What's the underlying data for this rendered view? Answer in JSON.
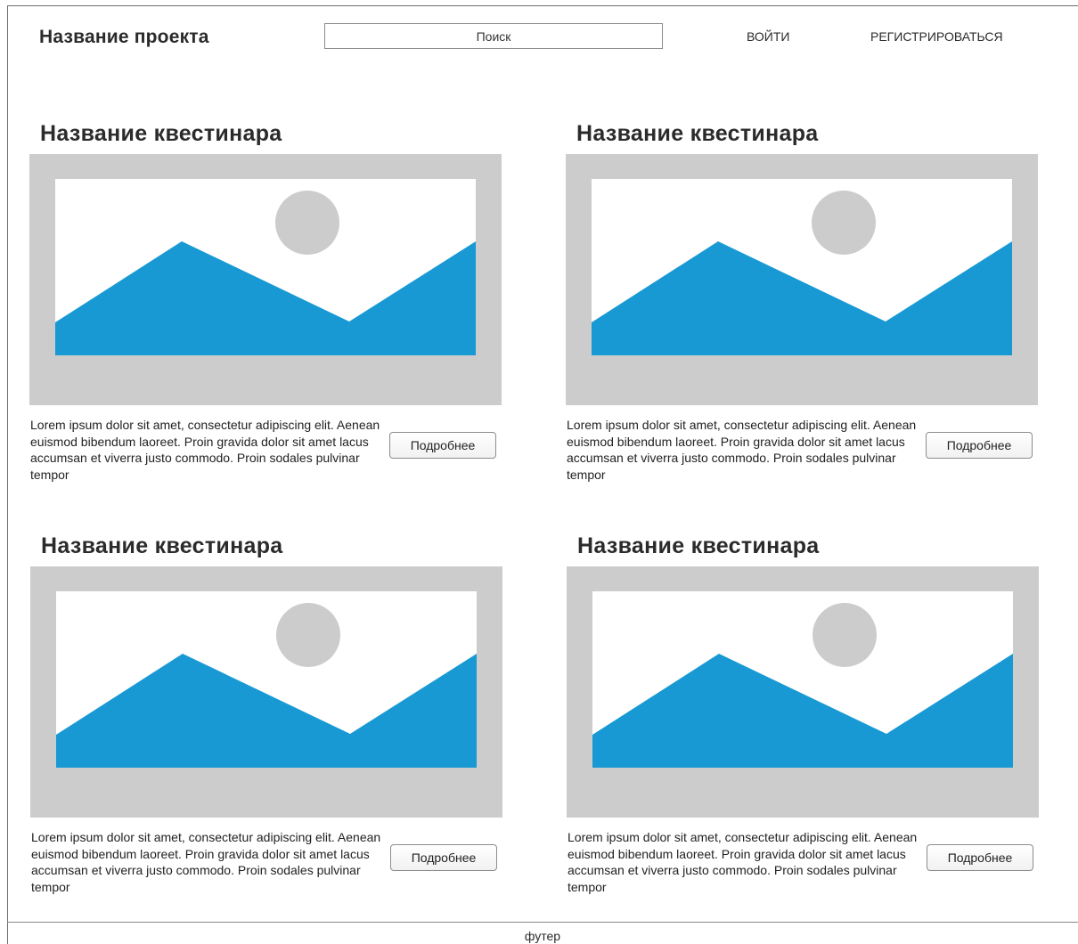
{
  "header": {
    "project_title": "Название проекта",
    "search_placeholder": "Поиск",
    "login_label": "ВОЙТИ",
    "register_label": "РЕГИСТРИРОВАТЬСЯ"
  },
  "cards": [
    {
      "title": "Название квестинара",
      "description": "Lorem ipsum dolor sit amet, consectetur adipiscing elit. Aenean euismod bibendum laoreet. Proin gravida dolor sit amet lacus accumsan et viverra justo commodo. Proin sodales pulvinar tempor",
      "button_label": "Подробнее",
      "image_icon": "image-placeholder-icon"
    },
    {
      "title": "Название квестинара",
      "description": "Lorem ipsum dolor sit amet, consectetur adipiscing elit. Aenean euismod bibendum laoreet. Proin gravida dolor sit amet lacus accumsan et viverra justo commodo. Proin sodales pulvinar tempor",
      "button_label": "Подробнее",
      "image_icon": "image-placeholder-icon"
    },
    {
      "title": "Название квестинара",
      "description": "Lorem ipsum dolor sit amet, consectetur adipiscing elit. Aenean euismod bibendum laoreet. Proin gravida dolor sit amet lacus accumsan et viverra justo commodo. Proin sodales pulvinar tempor",
      "button_label": "Подробнее",
      "image_icon": "image-placeholder-icon"
    },
    {
      "title": "Название квестинара",
      "description": "Lorem ipsum dolor sit amet, consectetur adipiscing elit. Aenean euismod bibendum laoreet. Proin gravida dolor sit amet lacus accumsan et viverra justo commodo. Proin sodales pulvinar tempor",
      "button_label": "Подробнее",
      "image_icon": "image-placeholder-icon"
    }
  ],
  "footer": {
    "label": "футер"
  },
  "colors": {
    "image_background": "#cccccc",
    "mountain": "#1899d4",
    "sun": "#cccccc"
  }
}
